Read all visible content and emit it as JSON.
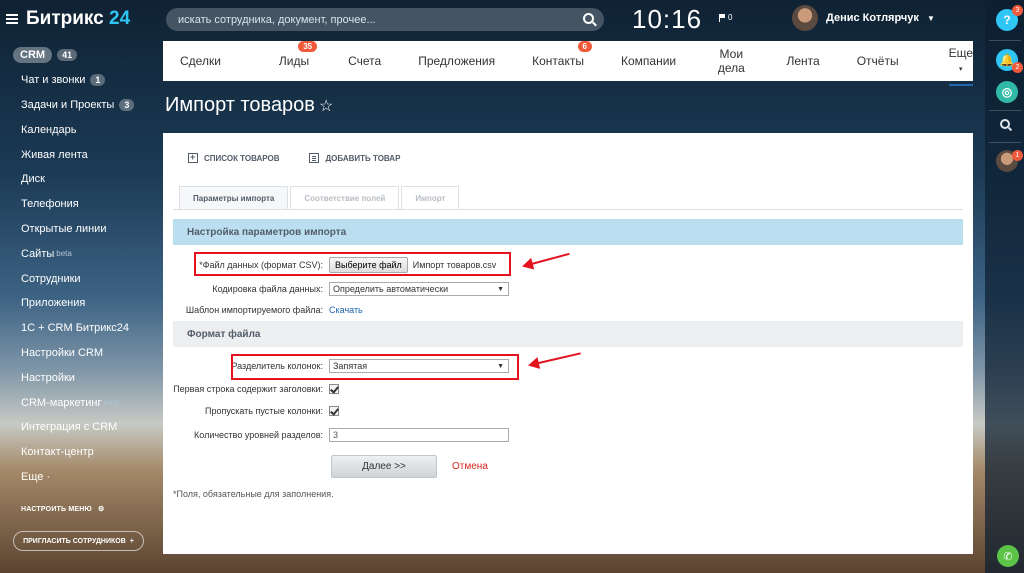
{
  "logo": {
    "name": "Битрикс",
    "num": "24"
  },
  "sidebar": {
    "crm": {
      "label": "CRM",
      "count": "41"
    },
    "items": [
      {
        "label": "Чат и звонки",
        "count": "1"
      },
      {
        "label": "Задачи и Проекты",
        "count": "3"
      },
      {
        "label": "Календарь"
      },
      {
        "label": "Живая лента"
      },
      {
        "label": "Диск"
      },
      {
        "label": "Телефония"
      },
      {
        "label": "Открытые линии"
      },
      {
        "label": "Сайты",
        "beta": "beta"
      },
      {
        "label": "Сотрудники"
      },
      {
        "label": "Приложения"
      },
      {
        "label": "1С + CRM Битрикс24"
      },
      {
        "label": "Настройки CRM"
      },
      {
        "label": "Настройки"
      },
      {
        "label": "CRM-маркетинг",
        "beta": "beta"
      },
      {
        "label": "Интеграция с CRM"
      },
      {
        "label": "Контакт-центр"
      },
      {
        "label": "Еще ·"
      }
    ],
    "configure_label": "НАСТРОИТЬ МЕНЮ",
    "invite_label": "ПРИГЛАСИТЬ СОТРУДНИКОВ"
  },
  "header": {
    "search_placeholder": "искать сотрудника, документ, прочее...",
    "clock": "10:16",
    "flag_count": "0",
    "user_name": "Денис Котлярчук"
  },
  "topnav": [
    {
      "label": "Сделки"
    },
    {
      "label": "Лиды",
      "badge": "35"
    },
    {
      "label": "Счета"
    },
    {
      "label": "Предложения"
    },
    {
      "label": "Контакты",
      "badge": "6"
    },
    {
      "label": "Компании"
    },
    {
      "label": "Мои дела"
    },
    {
      "label": "Лента"
    },
    {
      "label": "Отчёты"
    },
    {
      "label": "Еще"
    }
  ],
  "rightbar": {
    "help_badge": "3",
    "notif_badge": "2",
    "user_badge": "1"
  },
  "page": {
    "title": "Импорт товаров",
    "star": "☆",
    "actions": {
      "list": "СПИСОК ТОВАРОВ",
      "add": "ДОБАВИТЬ ТОВАР"
    },
    "tabs": [
      "Параметры импорта",
      "Соответствие полей",
      "Импорт"
    ],
    "section1": "Настройка параметров импорта",
    "section2": "Формат файла",
    "fields": {
      "file_label": "*Файл данных (формат CSV):",
      "file_button": "Выберите файл",
      "file_name": "Импорт товаров.csv",
      "encoding_label": "Кодировка файла данных:",
      "encoding_value": "Определить автоматически",
      "template_label": "Шаблон импортируемого файла:",
      "template_link": "Скачать",
      "delimiter_label": "Разделитель колонок:",
      "delimiter_value": "Запятая",
      "first_row_label": "Первая строка содержит заголовки:",
      "skip_empty_label": "Пропускать пустые колонки:",
      "levels_label": "Количество уровней разделов:",
      "levels_value": "3"
    },
    "next_button": "Далее >>",
    "cancel_link": "Отмена",
    "note": "*Поля, обязательные для заполнения."
  },
  "colors": {
    "accent": "#2067b0",
    "badge": "#f05a3a",
    "highlight": "#e3121e",
    "section": "#bbdff0"
  }
}
